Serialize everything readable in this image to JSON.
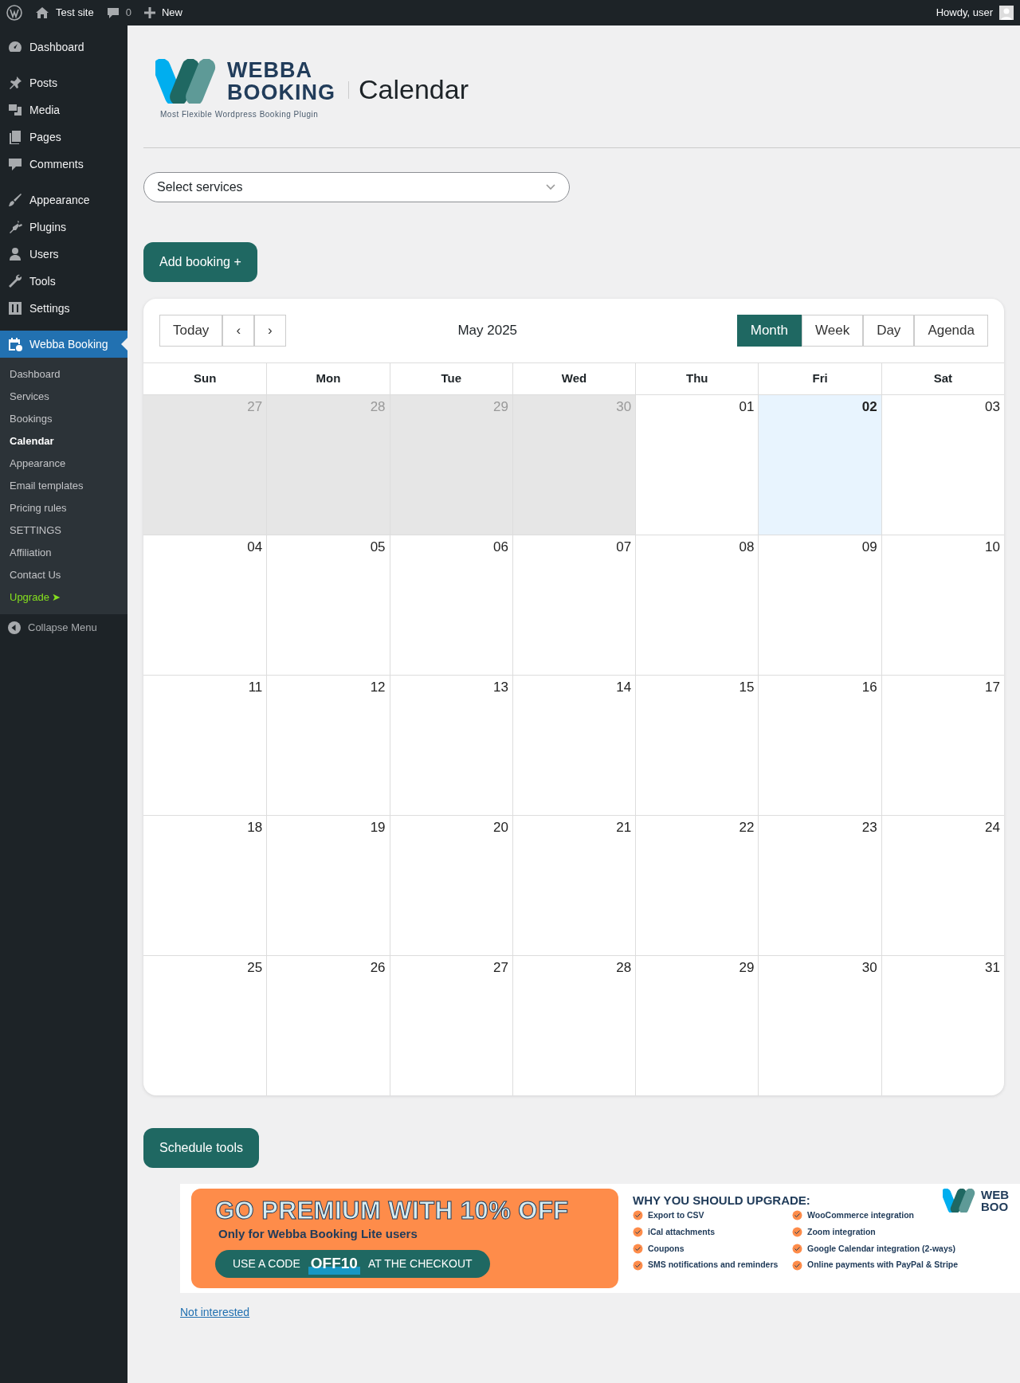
{
  "admin_bar": {
    "site": "Test site",
    "comments": "0",
    "new": "New",
    "greeting": "Howdy, user"
  },
  "sidebar": {
    "groups": [
      [
        {
          "label": "Dashboard",
          "selected": false
        }
      ],
      [
        {
          "label": "Posts",
          "selected": false
        },
        {
          "label": "Media",
          "selected": false
        },
        {
          "label": "Pages",
          "selected": false
        },
        {
          "label": "Comments",
          "selected": false
        }
      ],
      [
        {
          "label": "Appearance",
          "selected": false
        },
        {
          "label": "Plugins",
          "selected": false
        },
        {
          "label": "Users",
          "selected": false
        },
        {
          "label": "Tools",
          "selected": false
        },
        {
          "label": "Settings",
          "selected": false
        }
      ],
      [
        {
          "label": "Webba Booking",
          "selected": true
        }
      ]
    ],
    "submenu": [
      {
        "label": "Dashboard",
        "selected": false,
        "kind": "link"
      },
      {
        "label": "Services",
        "selected": false,
        "kind": "link"
      },
      {
        "label": "Bookings",
        "selected": false,
        "kind": "link"
      },
      {
        "label": "Calendar",
        "selected": true,
        "kind": "link"
      },
      {
        "label": "Appearance",
        "selected": false,
        "kind": "link"
      },
      {
        "label": "Email templates",
        "selected": false,
        "kind": "link"
      },
      {
        "label": "Pricing rules",
        "selected": false,
        "kind": "link"
      },
      {
        "label": "SETTINGS",
        "selected": false,
        "kind": "link"
      },
      {
        "label": "Affiliation",
        "selected": false,
        "kind": "link"
      },
      {
        "label": "Contact Us",
        "selected": false,
        "kind": "link"
      },
      {
        "label": "Upgrade ➤",
        "selected": false,
        "kind": "upgrade"
      }
    ],
    "collapse": "Collapse Menu"
  },
  "header": {
    "logo_line1": "WEBBA",
    "logo_line2": "BOOKING",
    "logo_tagline": "Most Flexible Wordpress Booking Plugin",
    "title": "Calendar"
  },
  "service_select": {
    "placeholder": "Select services"
  },
  "add_booking": "Add booking +",
  "calendar": {
    "nav": [
      "Today",
      "‹",
      "›"
    ],
    "title": "May 2025",
    "views": [
      {
        "label": "Month",
        "selected": true
      },
      {
        "label": "Week",
        "selected": false
      },
      {
        "label": "Day",
        "selected": false
      },
      {
        "label": "Agenda",
        "selected": false
      }
    ],
    "weekdays": [
      "Sun",
      "Mon",
      "Tue",
      "Wed",
      "Thu",
      "Fri",
      "Sat"
    ],
    "weeks": [
      [
        {
          "day": "27",
          "other_month": true,
          "today": false
        },
        {
          "day": "28",
          "other_month": true,
          "today": false
        },
        {
          "day": "29",
          "other_month": true,
          "today": false
        },
        {
          "day": "30",
          "other_month": true,
          "today": false
        },
        {
          "day": "01",
          "other_month": false,
          "today": false
        },
        {
          "day": "02",
          "other_month": false,
          "today": true
        },
        {
          "day": "03",
          "other_month": false,
          "today": false
        }
      ],
      [
        {
          "day": "04",
          "other_month": false,
          "today": false
        },
        {
          "day": "05",
          "other_month": false,
          "today": false
        },
        {
          "day": "06",
          "other_month": false,
          "today": false
        },
        {
          "day": "07",
          "other_month": false,
          "today": false
        },
        {
          "day": "08",
          "other_month": false,
          "today": false
        },
        {
          "day": "09",
          "other_month": false,
          "today": false
        },
        {
          "day": "10",
          "other_month": false,
          "today": false
        }
      ],
      [
        {
          "day": "11",
          "other_month": false,
          "today": false
        },
        {
          "day": "12",
          "other_month": false,
          "today": false
        },
        {
          "day": "13",
          "other_month": false,
          "today": false
        },
        {
          "day": "14",
          "other_month": false,
          "today": false
        },
        {
          "day": "15",
          "other_month": false,
          "today": false
        },
        {
          "day": "16",
          "other_month": false,
          "today": false
        },
        {
          "day": "17",
          "other_month": false,
          "today": false
        }
      ],
      [
        {
          "day": "18",
          "other_month": false,
          "today": false
        },
        {
          "day": "19",
          "other_month": false,
          "today": false
        },
        {
          "day": "20",
          "other_month": false,
          "today": false
        },
        {
          "day": "21",
          "other_month": false,
          "today": false
        },
        {
          "day": "22",
          "other_month": false,
          "today": false
        },
        {
          "day": "23",
          "other_month": false,
          "today": false
        },
        {
          "day": "24",
          "other_month": false,
          "today": false
        }
      ],
      [
        {
          "day": "25",
          "other_month": false,
          "today": false
        },
        {
          "day": "26",
          "other_month": false,
          "today": false
        },
        {
          "day": "27",
          "other_month": false,
          "today": false
        },
        {
          "day": "28",
          "other_month": false,
          "today": false
        },
        {
          "day": "29",
          "other_month": false,
          "today": false
        },
        {
          "day": "30",
          "other_month": false,
          "today": false
        },
        {
          "day": "31",
          "other_month": false,
          "today": false
        }
      ]
    ]
  },
  "schedule_tools": "Schedule tools",
  "promo": {
    "headline": "GO PREMIUM WITH 10% OFF",
    "subline": "Only for Webba Booking Lite users",
    "code_prefix": "USE A CODE",
    "code": "OFF10",
    "code_suffix": "AT THE CHECKOUT",
    "features_title": "WHY YOU SHOULD UPGRADE:",
    "features": [
      "Export to CSV",
      "WooCommerce integration",
      "iCal attachments",
      "Zoom integration",
      "Coupons",
      "Google Calendar integration (2-ways)",
      "SMS notifications and reminders",
      "Online payments with PayPal & Stripe"
    ],
    "logo_line1": "WEB",
    "logo_line2": "BOO"
  },
  "not_interested": "Not interested"
}
